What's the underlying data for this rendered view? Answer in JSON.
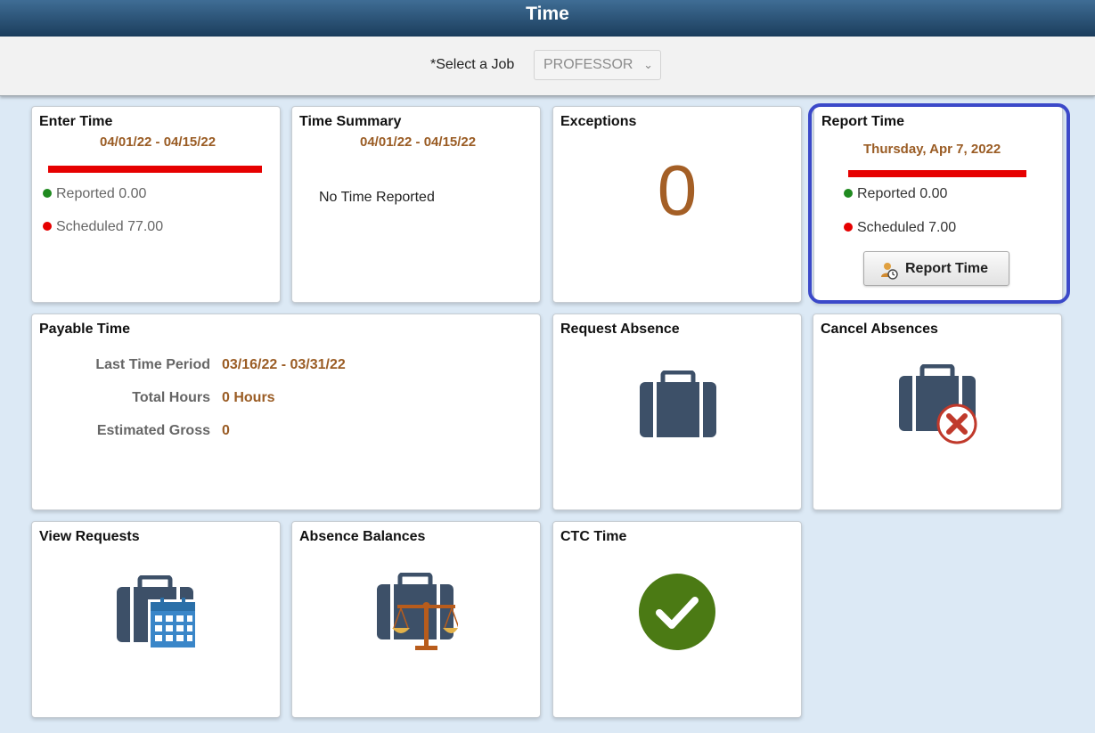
{
  "header": {
    "title": "Time"
  },
  "job": {
    "label": "*Select a Job",
    "value": "PROFESSOR"
  },
  "tiles": {
    "enter_time": {
      "title": "Enter Time",
      "period": "04/01/22 - 04/15/22",
      "reported": "Reported 0.00",
      "scheduled": "Scheduled 77.00"
    },
    "time_summary": {
      "title": "Time Summary",
      "period": "04/01/22 - 04/15/22",
      "message": "No Time Reported"
    },
    "exceptions": {
      "title": "Exceptions",
      "count": "0"
    },
    "report_time": {
      "title": "Report Time",
      "date": "Thursday, Apr 7, 2022",
      "reported": "Reported 0.00",
      "scheduled": "Scheduled 7.00",
      "button": "Report Time"
    },
    "payable_time": {
      "title": "Payable Time",
      "rows": [
        {
          "label": "Last Time Period",
          "value": "03/16/22 - 03/31/22"
        },
        {
          "label": "Total Hours",
          "value": "0 Hours"
        },
        {
          "label": "Estimated Gross",
          "value": "0"
        }
      ]
    },
    "request_absence": {
      "title": "Request Absence",
      "icon": "briefcase-icon"
    },
    "cancel_absences": {
      "title": "Cancel Absences",
      "icon": "briefcase-cancel-icon"
    },
    "view_requests": {
      "title": "View Requests",
      "icon": "briefcase-calendar-icon"
    },
    "absence_balances": {
      "title": "Absence Balances",
      "icon": "briefcase-scales-icon"
    },
    "ctc_time": {
      "title": "CTC Time",
      "icon": "checkmark-icon"
    }
  },
  "colors": {
    "accent_date": "#9a5c24",
    "reported_dot": "#1f8a1f",
    "scheduled_dot": "#e60000",
    "highlight": "#3b49c9",
    "briefcase": "#3d5068",
    "check": "#4b7a14"
  }
}
